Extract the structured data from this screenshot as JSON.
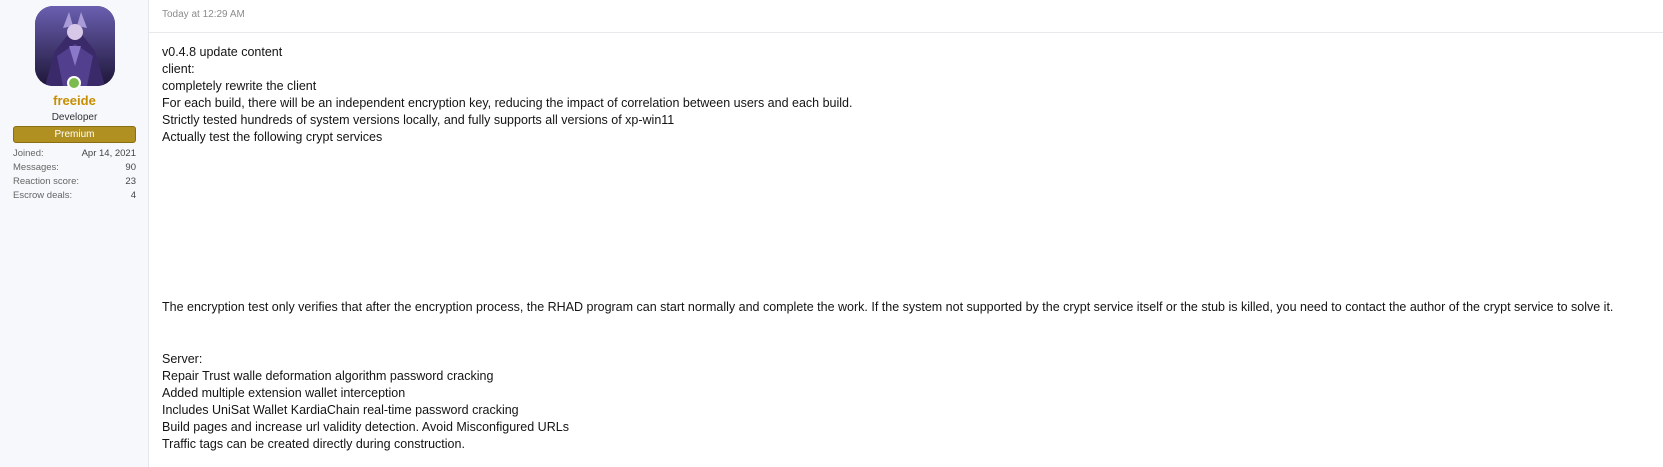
{
  "user": {
    "name": "freeide",
    "title": "Developer",
    "banner": "Premium",
    "stats": [
      {
        "label": "Joined:",
        "value": "Apr 14, 2021"
      },
      {
        "label": "Messages:",
        "value": "90"
      },
      {
        "label": "Reaction score:",
        "value": "23"
      },
      {
        "label": "Escrow deals:",
        "value": "4"
      }
    ],
    "accent_color": "#c68e00",
    "banner_color": "#b09020"
  },
  "post": {
    "date": "Today at 12:29 AM",
    "lines": [
      "v0.4.8 update content",
      "client:",
      "completely rewrite the client",
      "For each build, there will be an independent encryption key, reducing the impact of correlation between users and each build.",
      "Strictly tested hundreds of system versions locally, and fully supports all versions of xp-win11",
      "Actually test the following crypt services",
      "The encryption test only verifies that after the encryption process, the RHAD program can start normally and complete the work. If the system not supported by the crypt service itself or the stub is killed, you need to contact the author of the crypt service to solve it.",
      "Server:",
      "Repair Trust walle deformation algorithm password cracking",
      "Added multiple extension wallet interception",
      "Includes UniSat Wallet KardiaChain real-time password cracking",
      "Build pages and increase url validity detection. Avoid Misconfigured URLs",
      "Traffic tags can be created directly during construction."
    ]
  }
}
